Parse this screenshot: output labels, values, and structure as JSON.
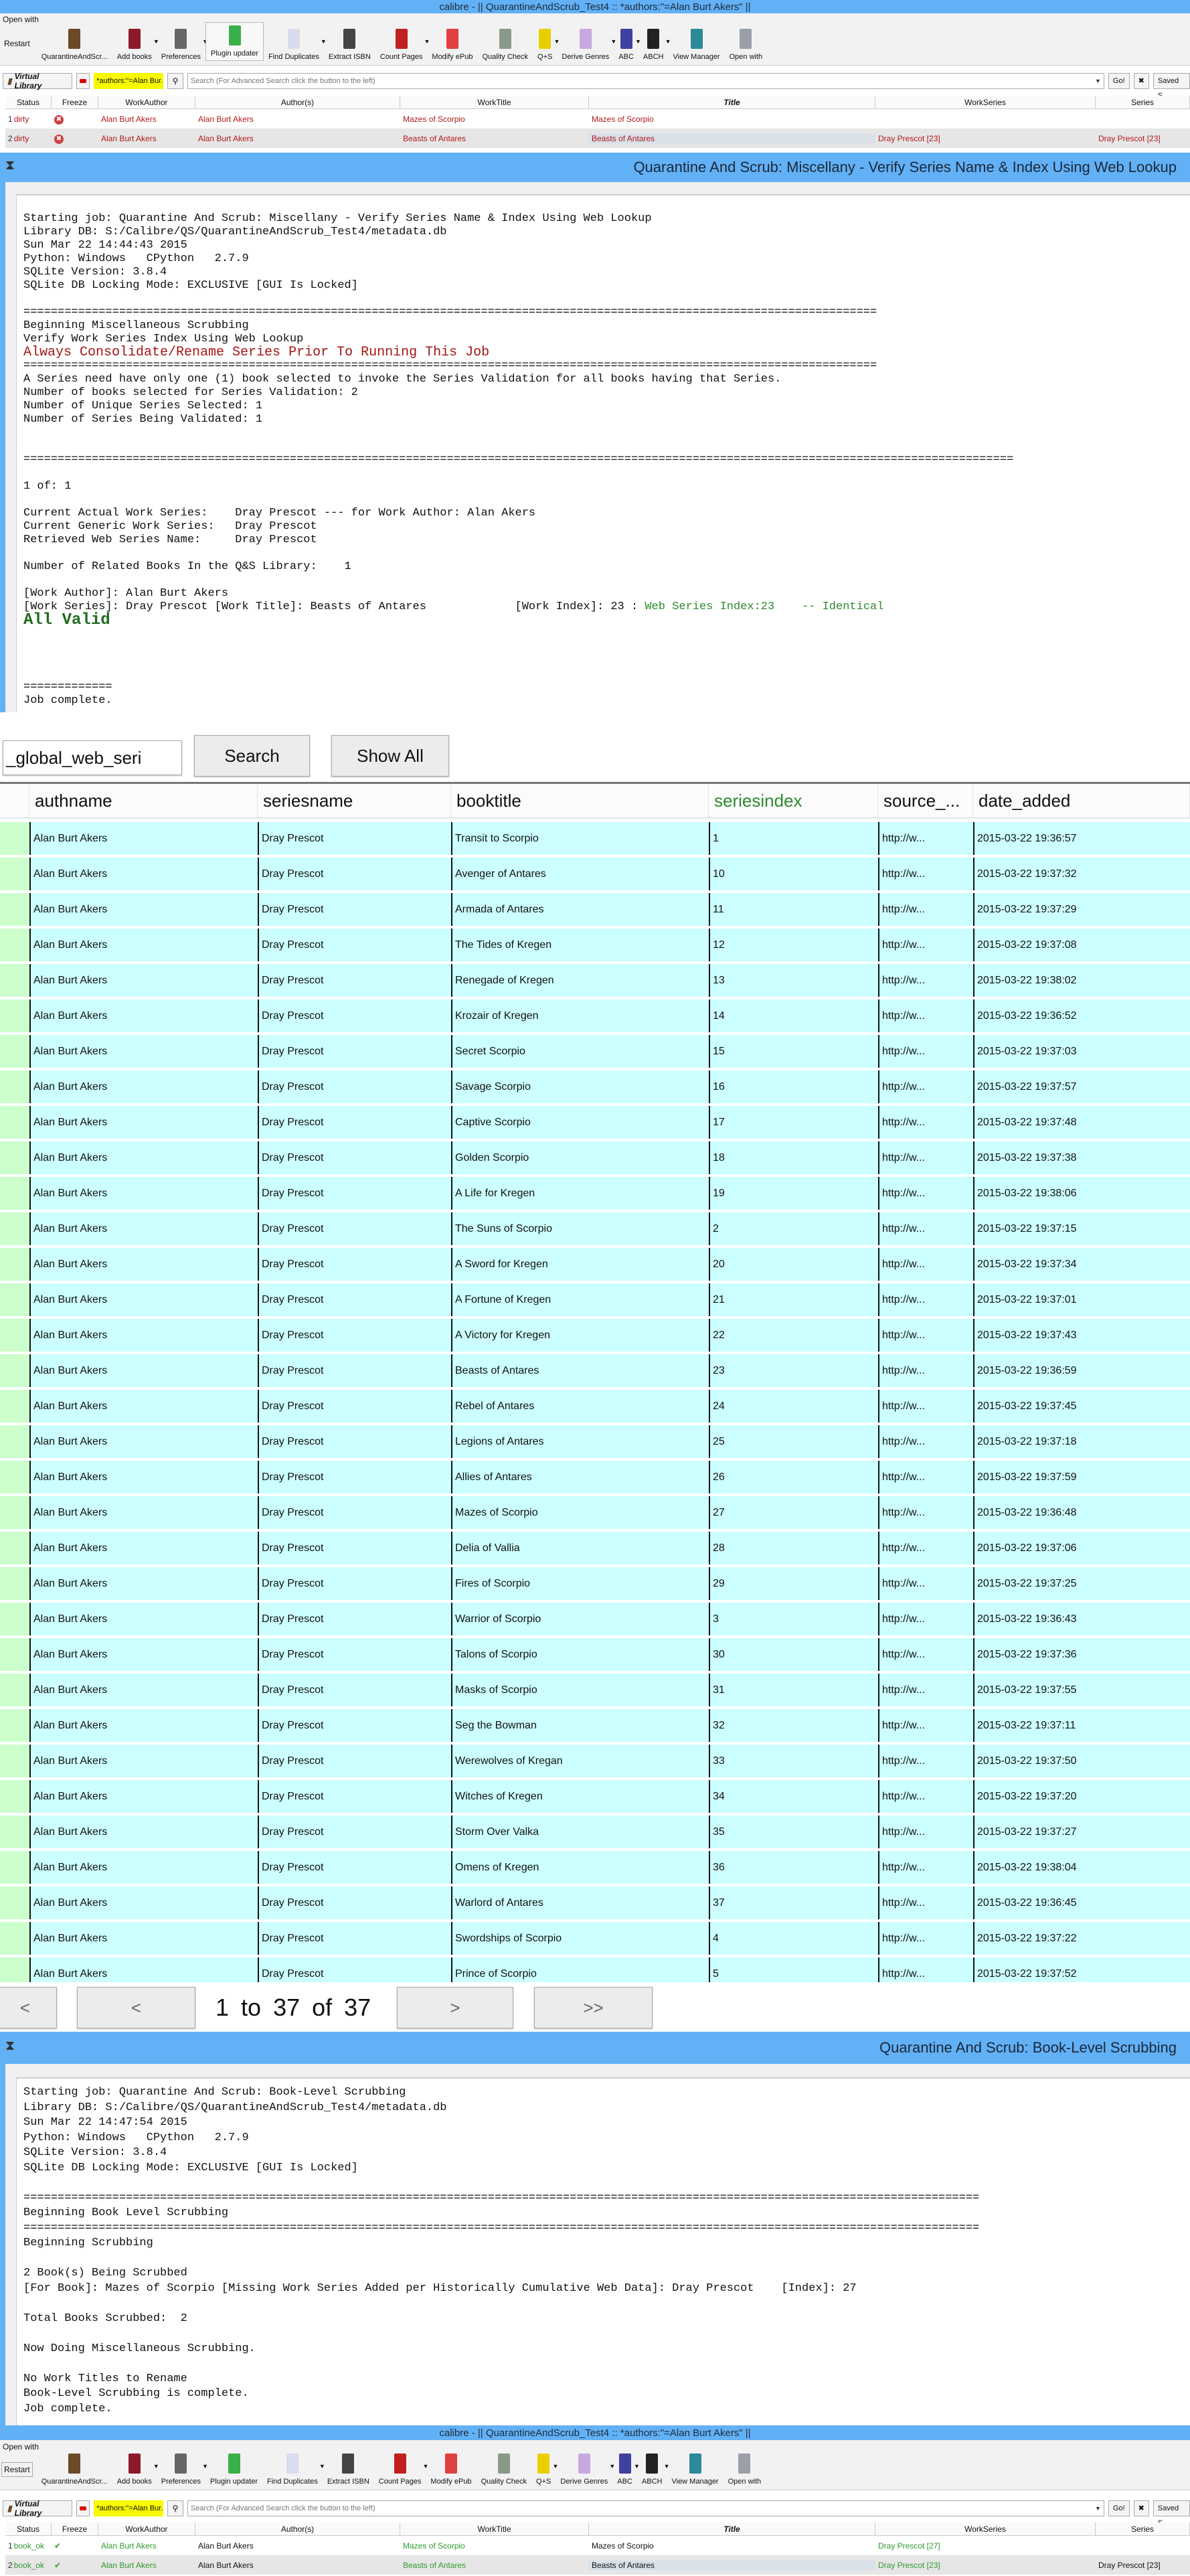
{
  "calibre": {
    "window_title": "calibre - || QuarantineAndScrub_Test4 :: *authors:\"=Alan Burt Akers\" ||",
    "menu": "Open with",
    "restart": "Restart",
    "toolbar": [
      {
        "label": "QuarantineAndScr...",
        "icon": "library-icon",
        "color": "#6b4a2a",
        "caret": false
      },
      {
        "label": "Add books",
        "icon": "add-books-icon",
        "color": "#8b1a2a",
        "caret": true
      },
      {
        "label": "Preferences",
        "icon": "preferences-icon",
        "color": "#666666",
        "caret": true
      },
      {
        "label": "Plugin updater",
        "icon": "plugin-updater-icon",
        "color": "#3ab04a",
        "caret": false,
        "highlight": true
      },
      {
        "label": "Find Duplicates",
        "icon": "find-duplicates-icon",
        "color": "#d8dcee",
        "caret": true
      },
      {
        "label": "Extract ISBN",
        "icon": "barcode-icon",
        "color": "#444444",
        "caret": false
      },
      {
        "label": "Count Pages",
        "icon": "count-pages-icon",
        "color": "#c02020",
        "caret": true
      },
      {
        "label": "Modify ePub",
        "icon": "modify-epub-icon",
        "color": "#e04040",
        "caret": false
      },
      {
        "label": "Quality Check",
        "icon": "quality-check-icon",
        "color": "#8a9a8a",
        "caret": false
      },
      {
        "label": "Q+S",
        "icon": "biohazard-icon",
        "color": "#e8d000",
        "caret": true
      },
      {
        "label": "Derive Genres",
        "icon": "derive-genres-icon",
        "color": "#c8a8e0",
        "caret": true
      },
      {
        "label": "ABC",
        "icon": "abc-icon",
        "color": "#4040a0",
        "caret": true
      },
      {
        "label": "ABCH",
        "icon": "abch-icon",
        "color": "#222222",
        "caret": true
      },
      {
        "label": "View Manager",
        "icon": "view-manager-icon",
        "color": "#2a8a9a",
        "caret": false
      },
      {
        "label": "Open with",
        "icon": "open-with-icon",
        "color": "#9aa0a8",
        "caret": false
      }
    ],
    "virtual_library": "Virtual Library",
    "saved_search": "*authors:\"=Alan Bur...",
    "search_placeholder": "Search (For Advanced Search click the button to the left)",
    "go": "Go!",
    "saved": "Saved S",
    "columns": [
      "Status",
      "Freeze",
      "WorkAuthor",
      "Author(s)",
      "WorkTitle",
      "Title",
      "WorkSeries",
      "Series"
    ],
    "before_rows": [
      {
        "n": "1",
        "status": "dirty",
        "freeze": "x",
        "workauthor": "Alan Burt Akers",
        "authors": "Alan Burt Akers",
        "worktitle": "Mazes of Scorpio",
        "title": "Mazes of Scorpio",
        "workseries": "",
        "series": ""
      },
      {
        "n": "2",
        "status": "dirty",
        "freeze": "x",
        "workauthor": "Alan Burt Akers",
        "authors": "Alan Burt Akers",
        "worktitle": "Beasts of Antares",
        "title": "Beasts of Antares",
        "workseries": "Dray Prescot [23]",
        "series": "Dray Prescot [23]"
      }
    ],
    "after_rows": [
      {
        "n": "1",
        "status": "book_ok",
        "freeze": "check",
        "workauthor": "Alan Burt Akers",
        "authors": "Alan Burt Akers",
        "worktitle": "Mazes of Scorpio",
        "title": "Mazes of Scorpio",
        "workseries": "Dray Prescot [27]",
        "series": ""
      },
      {
        "n": "2",
        "status": "book_ok",
        "freeze": "check",
        "workauthor": "Alan Burt Akers",
        "authors": "Alan Burt Akers",
        "worktitle": "Beasts of Antares",
        "title": "Beasts of Antares",
        "workseries": "Dray Prescot [23]",
        "series": "Dray Prescot [23]"
      }
    ]
  },
  "log1": {
    "title": "Quarantine And Scrub: Miscellany - Verify Series Name & Index Using Web Lookup",
    "lines": [
      {
        "t": "Starting job: Quarantine And Scrub: Miscellany - Verify Series Name & Index Using Web Lookup"
      },
      {
        "t": "Library DB: S:/Calibre/QS/QuarantineAndScrub_Test4/metadata.db"
      },
      {
        "t": "Sun Mar 22 14:44:43 2015"
      },
      {
        "t": "Python: Windows   CPython   2.7.9"
      },
      {
        "t": "SQLite Version: 3.8.4"
      },
      {
        "t": "SQLite DB Locking Mode: EXCLUSIVE [GUI Is Locked]"
      },
      {
        "t": ""
      },
      {
        "t": "============================================================================================================================="
      },
      {
        "t": "Beginning Miscellaneous Scrubbing"
      },
      {
        "t": "Verify Work Series Index Using Web Lookup"
      },
      {
        "t": "Always Consolidate/Rename Series Prior To Running This Job",
        "s": "warn"
      },
      {
        "t": "============================================================================================================================="
      },
      {
        "t": "A Series need have only one (1) book selected to invoke the Series Validation for all books having that Series."
      },
      {
        "t": "Number of books selected for Series Validation: 2"
      },
      {
        "t": "Number of Unique Series Selected: 1"
      },
      {
        "t": "Number of Series Being Validated: 1"
      },
      {
        "t": ""
      },
      {
        "t": ""
      },
      {
        "t": "================================================================================================================================================="
      },
      {
        "t": ""
      },
      {
        "t": "1 of: 1"
      },
      {
        "t": ""
      },
      {
        "t": "Current Actual Work Series:    Dray Prescot --- for Work Author: Alan Akers"
      },
      {
        "t": "Current Generic Work Series:   Dray Prescot"
      },
      {
        "t": "Retrieved Web Series Name:     Dray Prescot"
      },
      {
        "t": ""
      },
      {
        "t": "Number of Related Books In the Q&S Library:    1"
      },
      {
        "t": ""
      },
      {
        "t": "[Work Author]: Alan Burt Akers"
      },
      {
        "t": "[Work Series]: Dray Prescot [Work Title]: Beasts of Antares             [Work Index]: 23 : ",
        "g": "Web Series Index:23    -- Identical"
      },
      {
        "t": "All Valid",
        "s": "valid"
      },
      {
        "t": ""
      },
      {
        "t": ""
      },
      {
        "t": ""
      },
      {
        "t": ""
      },
      {
        "t": "============="
      },
      {
        "t": "Job complete."
      }
    ]
  },
  "search": {
    "value": "_global_web_seri",
    "search_button": "Search",
    "show_all_button": "Show All"
  },
  "grid": {
    "columns": [
      "authname",
      "seriesname",
      "booktitle",
      "seriesindex",
      "source_...",
      "date_added"
    ],
    "highlight_color": "#2e8b2e",
    "rows": [
      [
        "Alan Burt Akers",
        "Dray Prescot",
        "Transit to Scorpio",
        "1",
        "http://w...",
        "2015-03-22 19:36:57"
      ],
      [
        "Alan Burt Akers",
        "Dray Prescot",
        "Avenger of Antares",
        "10",
        "http://w...",
        "2015-03-22 19:37:32"
      ],
      [
        "Alan Burt Akers",
        "Dray Prescot",
        "Armada of Antares",
        "11",
        "http://w...",
        "2015-03-22 19:37:29"
      ],
      [
        "Alan Burt Akers",
        "Dray Prescot",
        "The Tides of Kregen",
        "12",
        "http://w...",
        "2015-03-22 19:37:08"
      ],
      [
        "Alan Burt Akers",
        "Dray Prescot",
        "Renegade of Kregen",
        "13",
        "http://w...",
        "2015-03-22 19:38:02"
      ],
      [
        "Alan Burt Akers",
        "Dray Prescot",
        "Krozair of Kregen",
        "14",
        "http://w...",
        "2015-03-22 19:36:52"
      ],
      [
        "Alan Burt Akers",
        "Dray Prescot",
        "Secret Scorpio",
        "15",
        "http://w...",
        "2015-03-22 19:37:03"
      ],
      [
        "Alan Burt Akers",
        "Dray Prescot",
        "Savage Scorpio",
        "16",
        "http://w...",
        "2015-03-22 19:37:57"
      ],
      [
        "Alan Burt Akers",
        "Dray Prescot",
        "Captive Scorpio",
        "17",
        "http://w...",
        "2015-03-22 19:37:48"
      ],
      [
        "Alan Burt Akers",
        "Dray Prescot",
        "Golden Scorpio",
        "18",
        "http://w...",
        "2015-03-22 19:37:38"
      ],
      [
        "Alan Burt Akers",
        "Dray Prescot",
        "A Life for Kregen",
        "19",
        "http://w...",
        "2015-03-22 19:38:06"
      ],
      [
        "Alan Burt Akers",
        "Dray Prescot",
        "The Suns of Scorpio",
        "2",
        "http://w...",
        "2015-03-22 19:37:15"
      ],
      [
        "Alan Burt Akers",
        "Dray Prescot",
        "A Sword for Kregen",
        "20",
        "http://w...",
        "2015-03-22 19:37:34"
      ],
      [
        "Alan Burt Akers",
        "Dray Prescot",
        "A Fortune of Kregen",
        "21",
        "http://w...",
        "2015-03-22 19:37:01"
      ],
      [
        "Alan Burt Akers",
        "Dray Prescot",
        "A Victory for Kregen",
        "22",
        "http://w...",
        "2015-03-22 19:37:43"
      ],
      [
        "Alan Burt Akers",
        "Dray Prescot",
        "Beasts of Antares",
        "23",
        "http://w...",
        "2015-03-22 19:36:59"
      ],
      [
        "Alan Burt Akers",
        "Dray Prescot",
        "Rebel of Antares",
        "24",
        "http://w...",
        "2015-03-22 19:37:45"
      ],
      [
        "Alan Burt Akers",
        "Dray Prescot",
        "Legions of Antares",
        "25",
        "http://w...",
        "2015-03-22 19:37:18"
      ],
      [
        "Alan Burt Akers",
        "Dray Prescot",
        "Allies of Antares",
        "26",
        "http://w...",
        "2015-03-22 19:37:59"
      ],
      [
        "Alan Burt Akers",
        "Dray Prescot",
        "Mazes of Scorpio",
        "27",
        "http://w...",
        "2015-03-22 19:36:48"
      ],
      [
        "Alan Burt Akers",
        "Dray Prescot",
        "Delia of Vallia",
        "28",
        "http://w...",
        "2015-03-22 19:37:06"
      ],
      [
        "Alan Burt Akers",
        "Dray Prescot",
        "Fires of Scorpio",
        "29",
        "http://w...",
        "2015-03-22 19:37:25"
      ],
      [
        "Alan Burt Akers",
        "Dray Prescot",
        "Warrior of Scorpio",
        "3",
        "http://w...",
        "2015-03-22 19:36:43"
      ],
      [
        "Alan Burt Akers",
        "Dray Prescot",
        "Talons of Scorpio",
        "30",
        "http://w...",
        "2015-03-22 19:37:36"
      ],
      [
        "Alan Burt Akers",
        "Dray Prescot",
        "Masks of Scorpio",
        "31",
        "http://w...",
        "2015-03-22 19:37:55"
      ],
      [
        "Alan Burt Akers",
        "Dray Prescot",
        "Seg the Bowman",
        "32",
        "http://w...",
        "2015-03-22 19:37:11"
      ],
      [
        "Alan Burt Akers",
        "Dray Prescot",
        "Werewolves of Kregan",
        "33",
        "http://w...",
        "2015-03-22 19:37:50"
      ],
      [
        "Alan Burt Akers",
        "Dray Prescot",
        "Witches of Kregen",
        "34",
        "http://w...",
        "2015-03-22 19:37:20"
      ],
      [
        "Alan Burt Akers",
        "Dray Prescot",
        "Storm Over Valka",
        "35",
        "http://w...",
        "2015-03-22 19:37:27"
      ],
      [
        "Alan Burt Akers",
        "Dray Prescot",
        "Omens of Kregen",
        "36",
        "http://w...",
        "2015-03-22 19:38:04"
      ],
      [
        "Alan Burt Akers",
        "Dray Prescot",
        "Warlord of Antares",
        "37",
        "http://w...",
        "2015-03-22 19:36:45"
      ],
      [
        "Alan Burt Akers",
        "Dray Prescot",
        "Swordships of Scorpio",
        "4",
        "http://w...",
        "2015-03-22 19:37:22"
      ],
      [
        "Alan Burt Akers",
        "Dray Prescot",
        "Prince of Scorpio",
        "5",
        "http://w...",
        "2015-03-22 19:37:52"
      ]
    ]
  },
  "pager": {
    "first": "<",
    "prev": "<",
    "from": "1",
    "to_word": "to",
    "to": "37",
    "of_word": "of",
    "total": "37",
    "next": ">",
    "last": ">>"
  },
  "log2": {
    "title": "Quarantine And Scrub: Book-Level Scrubbing",
    "lines": [
      {
        "t": "Starting job: Quarantine And Scrub: Book-Level Scrubbing"
      },
      {
        "t": "Library DB: S:/Calibre/QS/QuarantineAndScrub_Test4/metadata.db"
      },
      {
        "t": "Sun Mar 22 14:47:54 2015"
      },
      {
        "t": "Python: Windows   CPython   2.7.9"
      },
      {
        "t": "SQLite Version: 3.8.4"
      },
      {
        "t": "SQLite DB Locking Mode: EXCLUSIVE [GUI Is Locked]"
      },
      {
        "t": ""
      },
      {
        "t": "============================================================================================================================================"
      },
      {
        "t": "Beginning Book Level Scrubbing"
      },
      {
        "t": "============================================================================================================================================"
      },
      {
        "t": "Beginning Scrubbing"
      },
      {
        "t": ""
      },
      {
        "t": "2 Book(s) Being Scrubbed"
      },
      {
        "t": "[For Book]: Mazes of Scorpio [Missing Work Series Added per Historically Cumulative Web Data]: Dray Prescot    [Index]: 27"
      },
      {
        "t": ""
      },
      {
        "t": "Total Books Scrubbed:  2"
      },
      {
        "t": ""
      },
      {
        "t": "Now Doing Miscellaneous Scrubbing."
      },
      {
        "t": ""
      },
      {
        "t": "No Work Titles to Rename"
      },
      {
        "t": "Book-Level Scrubbing is complete."
      },
      {
        "t": "Job complete."
      }
    ]
  }
}
